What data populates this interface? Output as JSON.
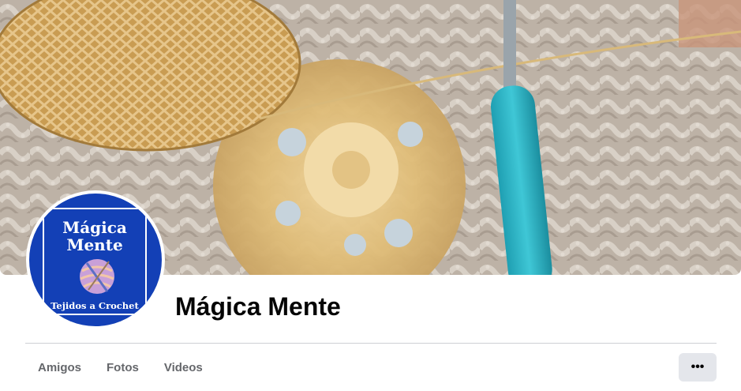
{
  "cover": {
    "description_colors": {
      "yarn": "#d9b46e",
      "lace": "#c8bcae",
      "hook": "#2bb3c4"
    }
  },
  "profile": {
    "logo_line1": "Mágica",
    "logo_line2": "Mente",
    "logo_tagline": "Tejidos a Crochet",
    "logo_bg": "#1340b6"
  },
  "page_name": "Mágica Mente",
  "tabs": [
    {
      "label": "Amigos"
    },
    {
      "label": "Fotos"
    },
    {
      "label": "Videos"
    }
  ],
  "more_button": {
    "icon": "more-horizontal-icon",
    "glyph": "•••"
  }
}
